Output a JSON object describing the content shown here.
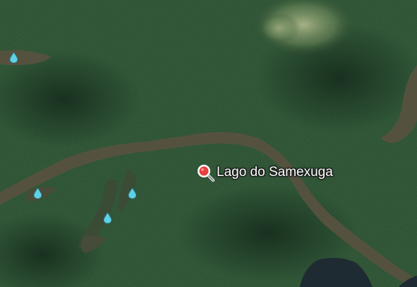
{
  "map": {
    "search_result": {
      "label": "Lago do Samexuga",
      "icon": "search-magnifier-icon",
      "pin_color": "#e8403f"
    },
    "water_markers": {
      "icon": "water-drop-icon",
      "color": "#5fd0e6",
      "count": 4
    },
    "colors": {
      "forest": "#24462a",
      "forest_dark": "#183520",
      "river": "#54523f",
      "clearing": "#9aa77d",
      "lake_dark": "#1f2b33"
    }
  }
}
